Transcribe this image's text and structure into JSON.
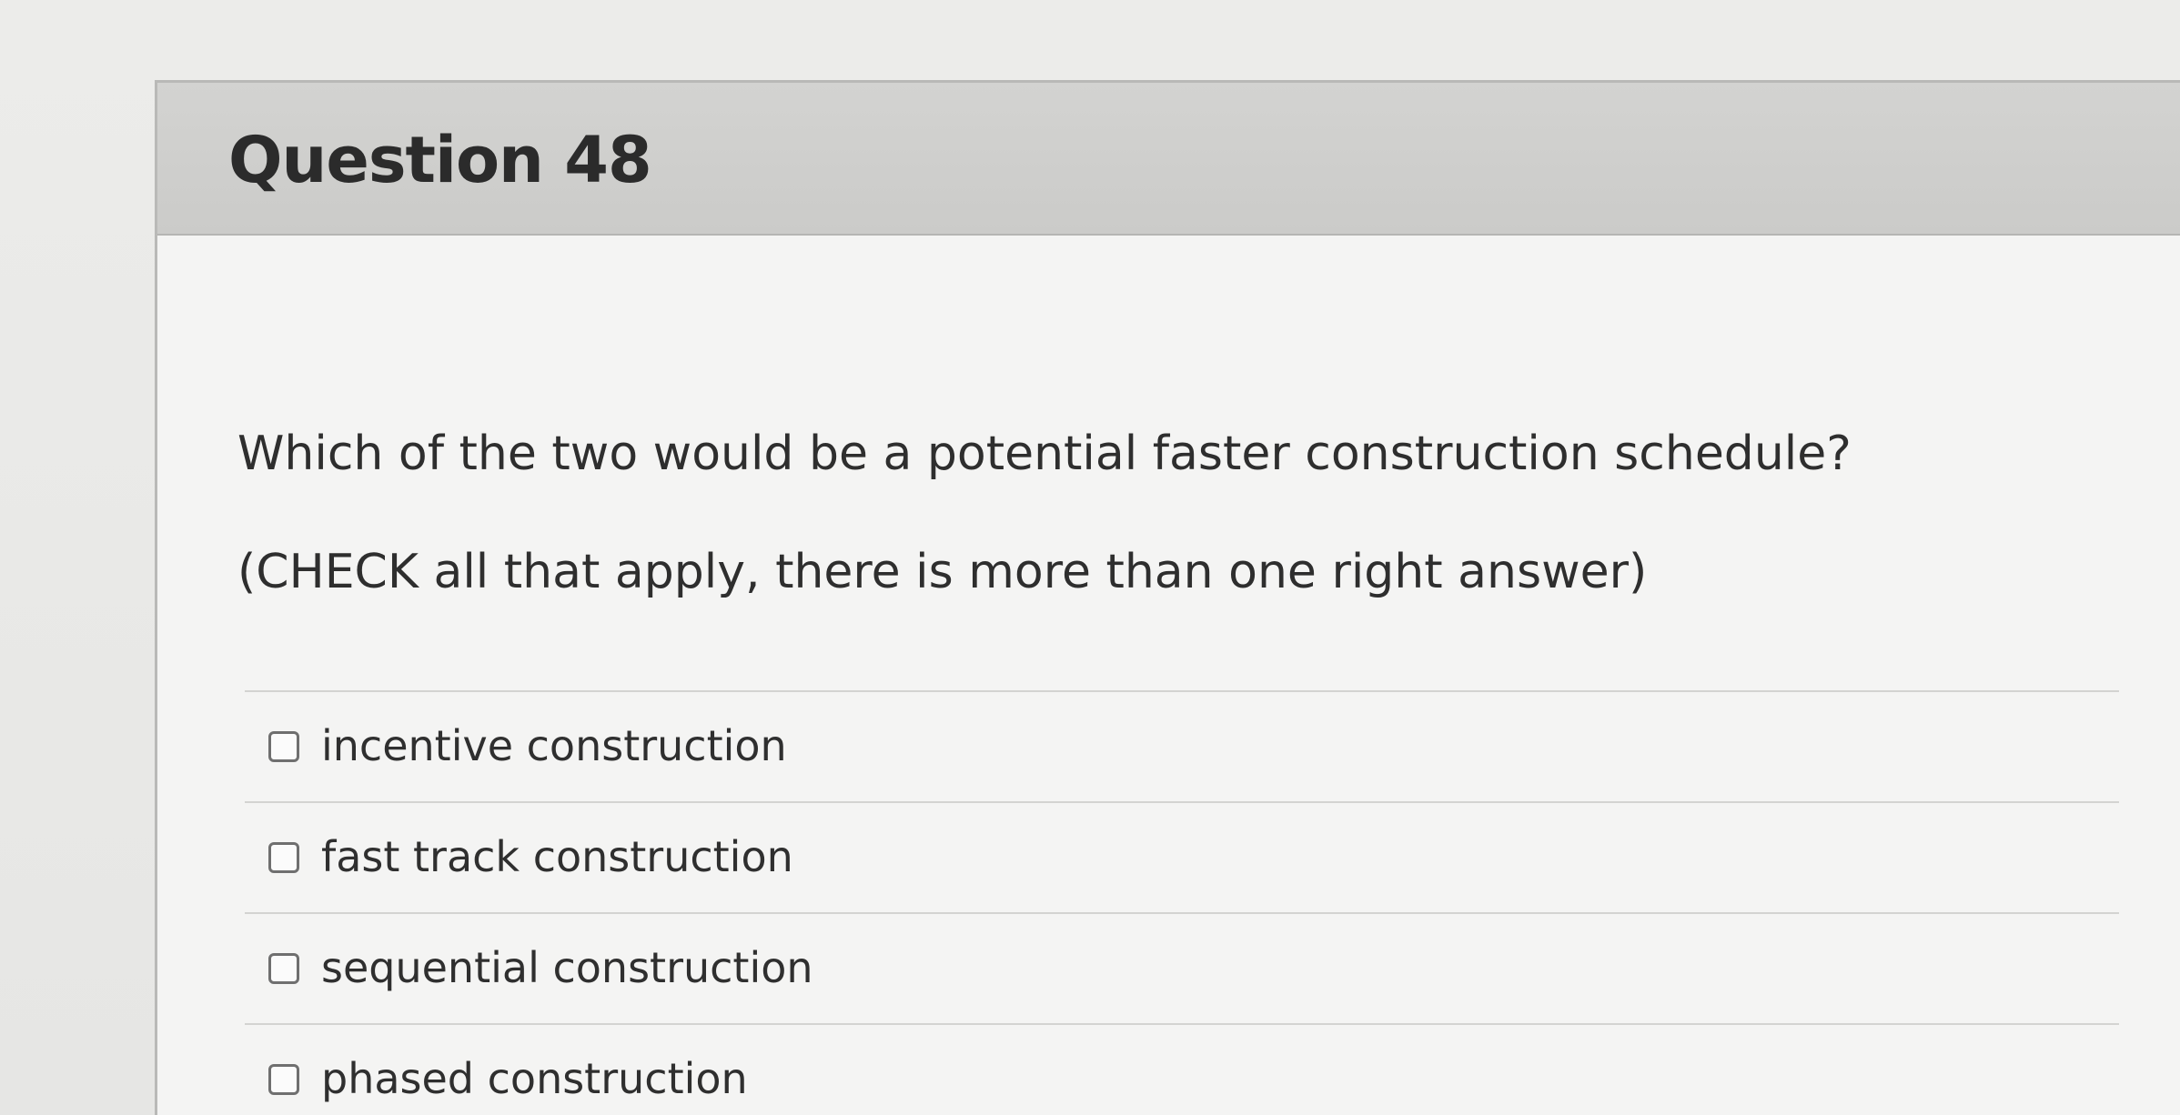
{
  "question": {
    "title": "Question 48",
    "prompt": "Which of the two would be a potential faster construction schedule?",
    "instruction": "(CHECK all that apply, there is more than one right answer)"
  },
  "answers": [
    {
      "label": "incentive construction",
      "checked": false
    },
    {
      "label": "fast track construction",
      "checked": false
    },
    {
      "label": "sequential construction",
      "checked": false
    },
    {
      "label": "phased construction",
      "checked": false
    }
  ],
  "colors": {
    "header_background": "#cfcfcd",
    "card_background": "#f4f4f3",
    "text": "#2e2e2e"
  }
}
